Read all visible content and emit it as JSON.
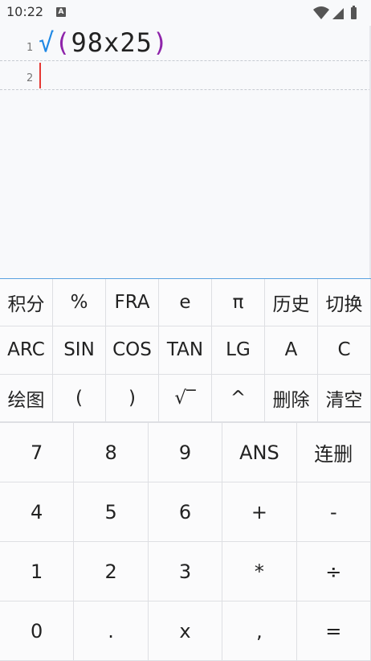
{
  "status_bar": {
    "time": "10:22",
    "notification_letter": "A"
  },
  "editor": {
    "lines": [
      {
        "number": "1",
        "sqrt": "√",
        "open_paren": "(",
        "body": "98x25",
        "close_paren": ")"
      },
      {
        "number": "2"
      }
    ]
  },
  "function_keys": [
    "积分",
    "%",
    "FRA",
    "e",
    "π",
    "历史",
    "切换",
    "ARC",
    "SIN",
    "COS",
    "TAN",
    "LG",
    "A",
    "C",
    "绘图",
    "(",
    ")",
    "√‾",
    "^",
    "删除",
    "清空"
  ],
  "numeric_keys": [
    "7",
    "8",
    "9",
    "ANS",
    "连删",
    "4",
    "5",
    "6",
    "+",
    "-",
    "1",
    "2",
    "3",
    "*",
    "÷",
    "0",
    ".",
    "x",
    ",",
    "="
  ],
  "colors": {
    "sqrt": "#1e88e5",
    "paren": "#8e24aa",
    "cursor": "#e53935",
    "divider": "#5aa1e0"
  }
}
